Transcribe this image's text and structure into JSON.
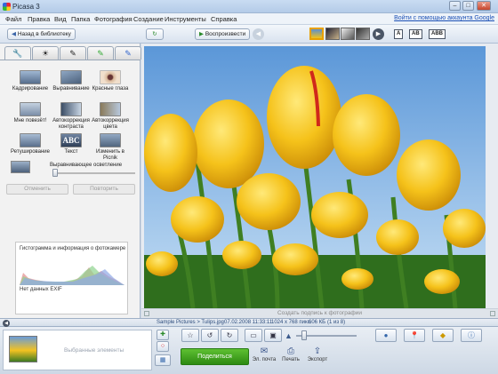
{
  "window": {
    "title": "Picasa 3",
    "controls": [
      "–",
      "□",
      "✕"
    ]
  },
  "menu": {
    "items": [
      "Файл",
      "Правка",
      "Вид",
      "Папка",
      "Фотография",
      "Создание",
      "Инструменты",
      "Справка"
    ],
    "google_link": "Войти с помощью аккаунта Google"
  },
  "toolbar": {
    "back_label": "Назад в библиотеку",
    "play_label": "Воспроизвести",
    "layout_buttons": [
      "A",
      "AB",
      "ABB"
    ]
  },
  "left_panel": {
    "tabs": [
      "wrench-icon",
      "sun-icon",
      "brush-icon",
      "green-brush-icon",
      "blue-brush-icon"
    ],
    "tools": [
      {
        "name": "crop",
        "label": "Кадрирование"
      },
      {
        "name": "straighten",
        "label": "Выравнивание"
      },
      {
        "name": "redeye",
        "label": "Красные глаза"
      },
      {
        "name": "feeling-lucky",
        "label": "Мне повезёт!"
      },
      {
        "name": "auto-contrast",
        "label": "Автокоррекция контраста"
      },
      {
        "name": "auto-color",
        "label": "Автокоррекция цвета"
      },
      {
        "name": "retouch",
        "label": "Ретуширование"
      },
      {
        "name": "text",
        "label": "Текст"
      },
      {
        "name": "picnik",
        "label": "Изменить в Picnik"
      }
    ],
    "fill_light_label": "Выравнивающее осветление",
    "fill_light_value": 0,
    "undo_label": "Отменить",
    "redo_label": "Повторить",
    "histogram": {
      "title": "Гистограмма и информация о фотокамере",
      "no_exif": "Нет данных EXIF"
    }
  },
  "photo": {
    "caption_placeholder": "Создать подпись к фотографии"
  },
  "infobar": {
    "path": "Sample Pictures > Tulips.jpg",
    "datetime": "07.02.2008 11:33:11",
    "dimensions": "1024 x 768 пикс.",
    "filesize": "606 КБ",
    "position": "(1 из 8)"
  },
  "bottom": {
    "selected_label": "Выбранные элементы",
    "share_label": "Поделиться",
    "actions": [
      {
        "icon": "envelope-icon",
        "label": "Эл. почта"
      },
      {
        "icon": "printer-icon",
        "label": "Печать"
      },
      {
        "icon": "export-icon",
        "label": "Экспорт"
      }
    ],
    "zoom_value": 0.1
  },
  "colors": {
    "share_green": "#3a9a1c",
    "link_blue": "#1a4fb5",
    "tulip_yellow": "#f5c21a"
  }
}
